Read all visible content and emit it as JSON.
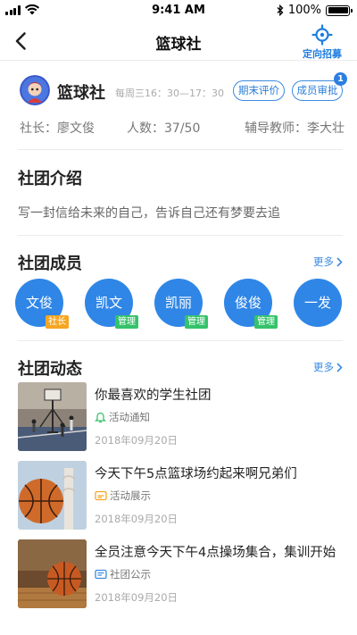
{
  "status_bar": {
    "time": "9:41 AM",
    "battery": "100%"
  },
  "nav": {
    "title": "篮球社",
    "recruit_label": "定向招募"
  },
  "club": {
    "name": "篮球社",
    "schedule": "每周三16：30—17：30",
    "evaluate_label": "期末评价",
    "approve_label": "成员审批",
    "approve_badge": "1",
    "leader": "社长：廖文俊",
    "member_count": "人数：37/50",
    "teacher": "辅导教师：李大壮"
  },
  "intro": {
    "title": "社团介绍",
    "text": "写一封信给未来的自己，告诉自己还有梦要去追"
  },
  "members": {
    "title": "社团成员",
    "more_label": "更多",
    "items": [
      {
        "name": "文俊",
        "role": "社长"
      },
      {
        "name": "凯文",
        "role": "管理"
      },
      {
        "name": "凯丽",
        "role": "管理"
      },
      {
        "name": "俊俊",
        "role": "管理"
      },
      {
        "name": "一发",
        "role": ""
      }
    ]
  },
  "activities": {
    "title": "社团动态",
    "more_label": "更多",
    "items": [
      {
        "title": "你最喜欢的学生社团",
        "tag": "活动通知",
        "date": "2018年09月20日",
        "tag_icon": "bell-icon"
      },
      {
        "title": "今天下午5点篮球场约起来啊兄弟们",
        "tag": "活动展示",
        "date": "2018年09月20日",
        "tag_icon": "image-icon"
      },
      {
        "title": "全员注意今天下午4点操场集合，集训开始",
        "tag": "社团公示",
        "date": "2018年09月20日",
        "tag_icon": "notice-icon"
      }
    ]
  },
  "colors": {
    "accent": "#2f86e6",
    "leader_tag": "#f5a623",
    "admin_tag": "#35c26a"
  }
}
